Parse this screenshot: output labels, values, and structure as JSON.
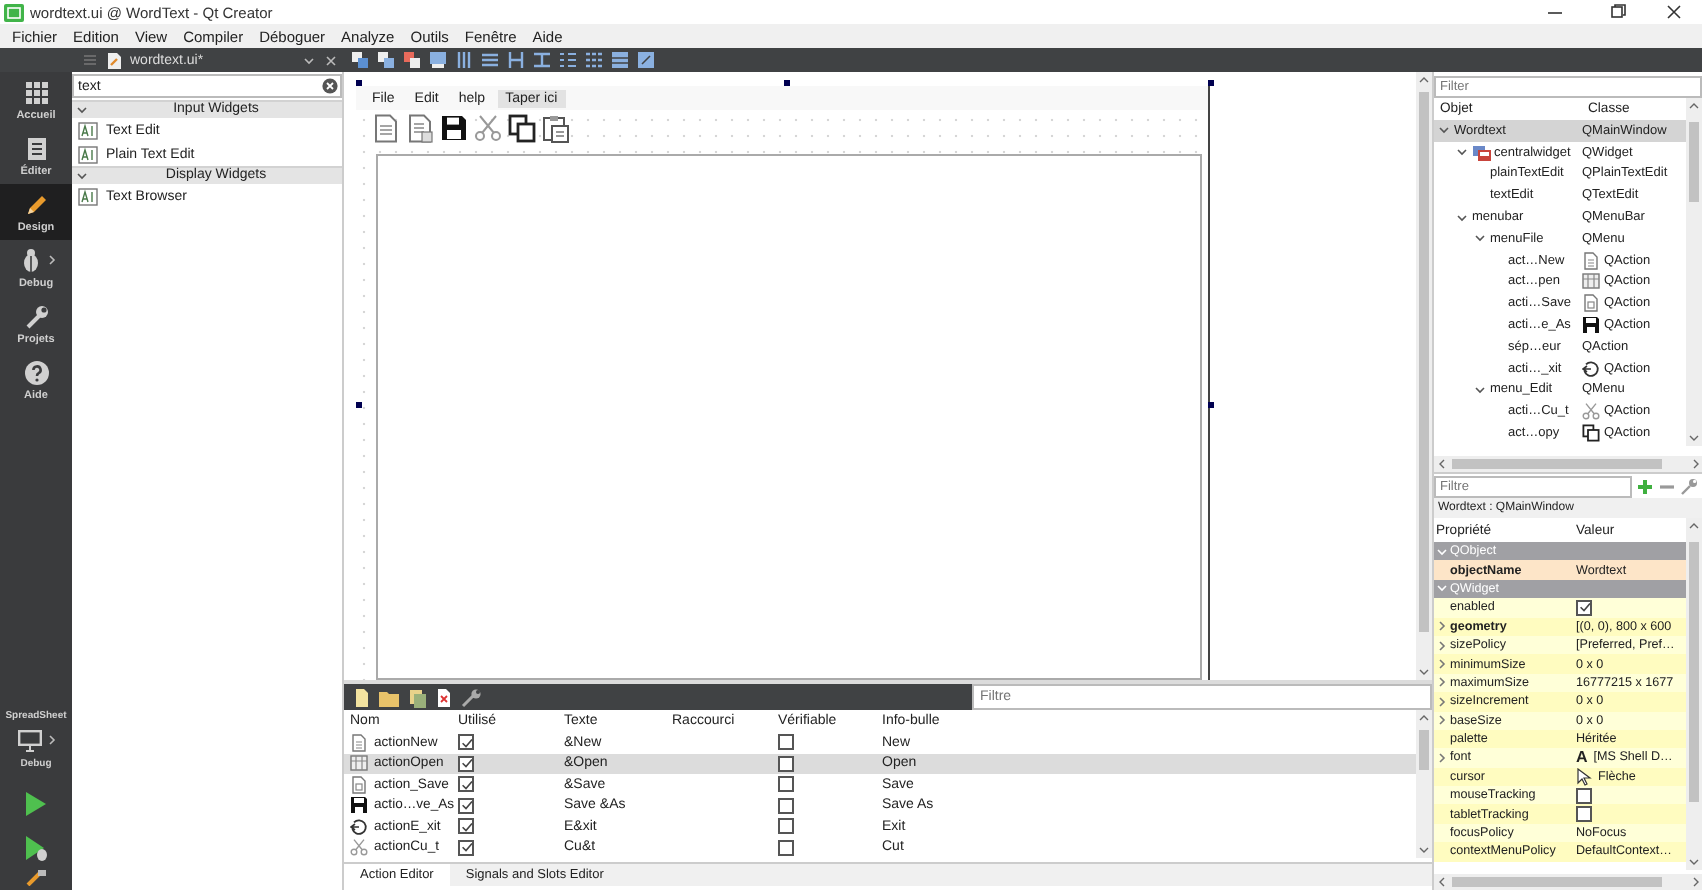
{
  "window": {
    "title": "wordtext.ui @ WordText - Qt Creator"
  },
  "menu_bar": [
    "Fichier",
    "Edition",
    "View",
    "Compiler",
    "Déboguer",
    "Analyze",
    "Outils",
    "Fenêtre",
    "Aide"
  ],
  "editor_tab": {
    "title": "wordtext.ui*"
  },
  "mode_bar": {
    "modes": [
      {
        "label": "Accueil",
        "kind": "welcome",
        "selected": false
      },
      {
        "label": "Éditer",
        "kind": "edit",
        "selected": false
      },
      {
        "label": "Design",
        "kind": "design",
        "selected": true
      },
      {
        "label": "Debug",
        "kind": "debug",
        "selected": false
      },
      {
        "label": "Projets",
        "kind": "projects",
        "selected": false
      },
      {
        "label": "Aide",
        "kind": "help",
        "selected": false
      }
    ],
    "kit": {
      "project": "SpreadSheet",
      "build": "Debug"
    }
  },
  "widget_box": {
    "search": {
      "value": "text"
    },
    "categories": [
      {
        "title": "Input Widgets",
        "expanded": true,
        "items": [
          "Text Edit",
          "Plain Text Edit"
        ]
      },
      {
        "title": "Display Widgets",
        "expanded": true,
        "items": [
          "Text Browser"
        ]
      }
    ]
  },
  "form": {
    "menu": [
      {
        "label": "File",
        "kind": "menu"
      },
      {
        "label": "Edit",
        "kind": "menu"
      },
      {
        "label": "help",
        "kind": "menu"
      },
      {
        "label": "Taper ici",
        "kind": "placeholder"
      }
    ]
  },
  "object_inspector": {
    "filter": {
      "placeholder": "Filter"
    },
    "columns": [
      "Objet",
      "Classe"
    ],
    "tree": [
      {
        "name": "Wordtext",
        "class": "QMainWindow",
        "selected": true,
        "expanded": true,
        "children": [
          {
            "name": "centralwidget",
            "class": "QWidget",
            "kind": "widget",
            "selected": false,
            "expanded": true,
            "children": [
              {
                "name": "plainTextEdit",
                "class": "QPlainTextEdit",
                "selected": false
              },
              {
                "name": "textEdit",
                "class": "QTextEdit",
                "selected": false
              }
            ]
          },
          {
            "name": "menubar",
            "class": "QMenuBar",
            "selected": false,
            "expanded": true,
            "children": [
              {
                "name": "menuFile",
                "class": "QMenu",
                "selected": false,
                "expanded": true,
                "children": [
                  {
                    "name": "act…New",
                    "class": "QAction",
                    "kind": "new",
                    "selected": false
                  },
                  {
                    "name": "act…pen",
                    "class": "QAction",
                    "kind": "open",
                    "selected": false
                  },
                  {
                    "name": "acti…Save",
                    "class": "QAction",
                    "kind": "save",
                    "selected": false
                  },
                  {
                    "name": "acti…e_As",
                    "class": "QAction",
                    "kind": "saveas",
                    "selected": false
                  },
                  {
                    "name": "sép…eur",
                    "class": "QAction",
                    "selected": false
                  },
                  {
                    "name": "acti…_xit",
                    "class": "QAction",
                    "kind": "exit",
                    "selected": false
                  }
                ]
              },
              {
                "name": "menu_Edit",
                "class": "QMenu",
                "selected": false,
                "expanded": true,
                "children": [
                  {
                    "name": "acti…Cu_t",
                    "class": "QAction",
                    "kind": "cut",
                    "selected": false
                  },
                  {
                    "name": "act…opy",
                    "class": "QAction",
                    "kind": "copy",
                    "selected": false
                  }
                ]
              }
            ]
          }
        ]
      }
    ]
  },
  "property_editor": {
    "filter": {
      "placeholder": "Filtre"
    },
    "context": "Wordtext : QMainWindow",
    "columns": [
      "Propriété",
      "Valeur"
    ],
    "rows": [
      {
        "kind": "group",
        "name": "QObject",
        "expanded": true,
        "selected": false
      },
      {
        "kind": "text",
        "name": "objectName",
        "value": "Wordtext",
        "modified": true,
        "selected": true
      },
      {
        "kind": "group",
        "name": "QWidget",
        "expanded": true,
        "selected": false
      },
      {
        "kind": "check",
        "name": "enabled",
        "checked": true,
        "selected": false
      },
      {
        "kind": "text",
        "name": "geometry",
        "value": "[(0, 0), 800 x 600",
        "modified": true,
        "expanded": false,
        "selected": false
      },
      {
        "kind": "text",
        "name": "sizePolicy",
        "value": "[Preferred, Pref…",
        "expanded": false,
        "selected": false
      },
      {
        "kind": "text",
        "name": "minimumSize",
        "value": "0 x 0",
        "expanded": false,
        "selected": false
      },
      {
        "kind": "text",
        "name": "maximumSize",
        "value": "16777215 x 1677",
        "expanded": false,
        "selected": false
      },
      {
        "kind": "text",
        "name": "sizeIncrement",
        "value": "0 x 0",
        "expanded": false,
        "selected": false
      },
      {
        "kind": "text",
        "name": "baseSize",
        "value": "0 x 0",
        "expanded": false,
        "selected": false
      },
      {
        "kind": "text",
        "name": "palette",
        "value": "Héritée",
        "selected": false
      },
      {
        "kind": "font",
        "name": "font",
        "preview": "A",
        "value": "[MS Shell D…",
        "expanded": false,
        "selected": false
      },
      {
        "kind": "cursor",
        "name": "cursor",
        "value": "Flèche",
        "selected": false
      },
      {
        "kind": "check",
        "name": "mouseTracking",
        "checked": false,
        "selected": false
      },
      {
        "kind": "check",
        "name": "tabletTracking",
        "checked": false,
        "selected": false
      },
      {
        "kind": "text",
        "name": "focusPolicy",
        "value": "NoFocus",
        "selected": false
      },
      {
        "kind": "text",
        "name": "contextMenuPolicy",
        "value": "DefaultContext…",
        "selected": false
      }
    ]
  },
  "action_editor": {
    "filter": {
      "placeholder": "Filtre"
    },
    "columns": [
      "Nom",
      "Utilisé",
      "Texte",
      "Raccourci",
      "Vérifiable",
      "Info-bulle"
    ],
    "rows": [
      {
        "kind": "new",
        "name": "actionNew",
        "used": true,
        "text": "&New",
        "checkable": false,
        "tooltip": "New",
        "selected": false
      },
      {
        "kind": "open",
        "name": "actionOpen",
        "used": true,
        "text": "&Open",
        "checkable": false,
        "tooltip": "Open",
        "selected": true
      },
      {
        "kind": "save",
        "name": "action_Save",
        "used": true,
        "text": "&Save",
        "checkable": false,
        "tooltip": "Save",
        "selected": false
      },
      {
        "kind": "saveas",
        "name": "actio…ve_As",
        "used": true,
        "text": "Save &As",
        "checkable": false,
        "tooltip": "Save As",
        "selected": false
      },
      {
        "kind": "exit",
        "name": "actionE_xit",
        "used": true,
        "text": "E&xit",
        "checkable": false,
        "tooltip": "Exit",
        "selected": false
      },
      {
        "kind": "cut",
        "name": "actionCu_t",
        "used": true,
        "text": "Cu&t",
        "checkable": false,
        "tooltip": "Cut",
        "selected": false
      }
    ],
    "tabs": [
      {
        "label": "Action Editor",
        "selected": true
      },
      {
        "label": "Signals and Slots Editor",
        "selected": false
      }
    ]
  }
}
